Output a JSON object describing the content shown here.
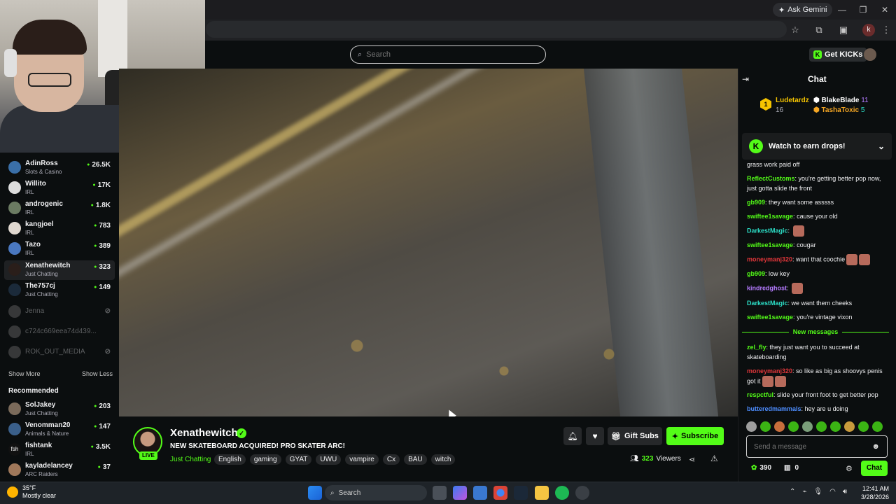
{
  "browser": {
    "ask_gemini": "Ask Gemini",
    "profile_initial": "k"
  },
  "header": {
    "search_placeholder": "Search",
    "get_kicks": "Get KICKs"
  },
  "sidebar": {
    "following": [
      {
        "name": "AdinRoss",
        "category": "Slots & Casino",
        "viewers": "26.5K",
        "live": true
      },
      {
        "name": "Willito",
        "category": "IRL",
        "viewers": "17K",
        "live": true
      },
      {
        "name": "androgenic",
        "category": "IRL",
        "viewers": "1.8K",
        "live": true
      },
      {
        "name": "kangjoel",
        "category": "IRL",
        "viewers": "783",
        "live": true
      },
      {
        "name": "Tazo",
        "category": "IRL",
        "viewers": "389",
        "live": true
      },
      {
        "name": "Xenathewitch",
        "category": "Just Chatting",
        "viewers": "323",
        "live": true
      },
      {
        "name": "The757cj",
        "category": "Just Chatting",
        "viewers": "149",
        "live": true
      },
      {
        "name": "Jenna",
        "category": "",
        "viewers": "",
        "live": false
      },
      {
        "name": "c724c669eea74d439...",
        "category": "",
        "viewers": "",
        "live": false
      },
      {
        "name": "ROK_OUT_MEDIA",
        "category": "",
        "viewers": "",
        "live": false
      }
    ],
    "show_more": "Show More",
    "show_less": "Show Less",
    "recommended_title": "Recommended",
    "recommended": [
      {
        "name": "SolJakey",
        "category": "Just Chatting",
        "viewers": "203"
      },
      {
        "name": "Venomman20",
        "category": "Animals & Nature",
        "viewers": "147"
      },
      {
        "name": "fishtank",
        "category": "IRL",
        "viewers": "3.5K"
      },
      {
        "name": "kayladelancey",
        "category": "ARC Raiders",
        "viewers": "37"
      }
    ]
  },
  "stream": {
    "live_badge": "LIVE",
    "streamer_name": "Xenathewitch",
    "title": "NEW SKATEBOARD ACQUIRED! PRO SKATER ARC!",
    "category": "Just Chatting",
    "tags": [
      "English",
      "gaming",
      "GYAT",
      "UWU",
      "vampire",
      "Cx",
      "BAU",
      "witch"
    ],
    "gift_subs": "Gift Subs",
    "subscribe": "Subscribe",
    "viewer_count": "323",
    "viewers_label": "Viewers"
  },
  "chat": {
    "title": "Chat",
    "leaderboard": {
      "first": {
        "rank": "1",
        "name": "Ludetardz",
        "count": "16"
      },
      "second": {
        "name": "BlakeBlade",
        "count": "11"
      },
      "third": {
        "name": "TashaToxic",
        "count": "5"
      }
    },
    "drops_banner": "Watch to earn drops!",
    "messages": [
      {
        "user": "",
        "text": "grass work paid off",
        "color": "#e9d23a"
      },
      {
        "user": "ReflectCustoms",
        "text": "you're getting better pop now, just gotta slide the front",
        "color": "#53fc18"
      },
      {
        "user": "gb909",
        "text": "they want some asssss",
        "color": "#53fc18"
      },
      {
        "user": "swiftee1savage",
        "text": "cause your old",
        "color": "#53fc18"
      },
      {
        "user": "DarkestMagic",
        "text": "",
        "color": "#2ce0c8"
      },
      {
        "user": "swiftee1savage",
        "text": "cougar",
        "color": "#53fc18"
      },
      {
        "user": "moneymanj320",
        "text": "want that coochie",
        "color": "#e0363a"
      },
      {
        "user": "gb909",
        "text": "low key",
        "color": "#53fc18"
      },
      {
        "user": "kindredghost",
        "text": "",
        "color": "#b57bff"
      },
      {
        "user": "DarkestMagic",
        "text": "we want them cheeks",
        "color": "#2ce0c8"
      },
      {
        "user": "swiftee1savage",
        "text": "you're vintage vixon",
        "color": "#53fc18"
      },
      {
        "user": "zel_fly",
        "text": "they just want you to succeed at skateboarding",
        "color": "#53fc18"
      },
      {
        "user": "moneymanj320",
        "text": "so like as big as shoovys penis got it",
        "color": "#e0363a"
      },
      {
        "user": "respctful",
        "text": "slide your front foot to get better pop",
        "color": "#53fc18"
      },
      {
        "user": "butteredmammals",
        "text": "hey are u doing",
        "color": "#4d8dff"
      }
    ],
    "new_messages": "New messages",
    "input_placeholder": "Send a message",
    "points": "390",
    "store_count": "0",
    "send": "Chat"
  },
  "taskbar": {
    "temp": "35°F",
    "weather": "Mostly clear",
    "search": "Search",
    "time": "12:41 AM",
    "date": "3/28/2026"
  },
  "colors": {
    "kick_green": "#53fc18",
    "bg": "#0b0e0f"
  }
}
